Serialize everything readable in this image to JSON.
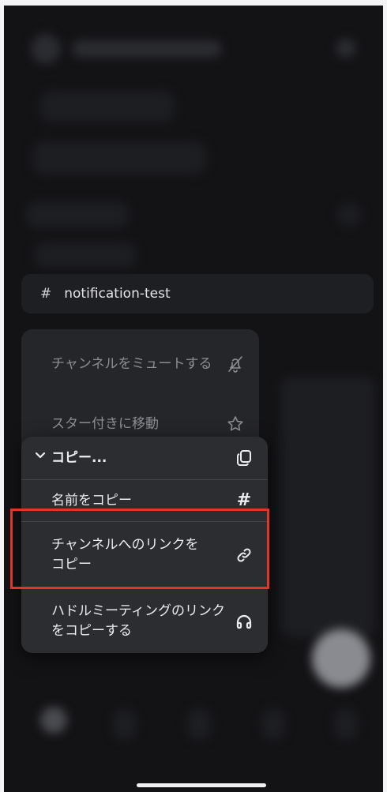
{
  "channel": {
    "hash": "#",
    "name": "notification-test"
  },
  "back_menu": {
    "items": [
      {
        "label": "チャンネルをミュートする",
        "icon": "bell-slash-icon"
      },
      {
        "label": "スター付きに移動",
        "icon": "star-outline-icon"
      }
    ]
  },
  "copy_menu": {
    "header": {
      "chevron": "⌄",
      "label": "コピー...",
      "icon": "copy-icon"
    },
    "items": [
      {
        "label": "名前をコピー",
        "icon_text": "#",
        "icon": "hash-icon"
      },
      {
        "label": "チャンネルへのリンクをコピー",
        "icon": "link-icon"
      },
      {
        "label": "ハドルミーティングのリンクをコピーする",
        "icon": "headphones-icon"
      }
    ]
  },
  "colors": {
    "highlight": "#e2352a",
    "menu_bg": "#2c2d31",
    "screen_bg": "#131316"
  }
}
